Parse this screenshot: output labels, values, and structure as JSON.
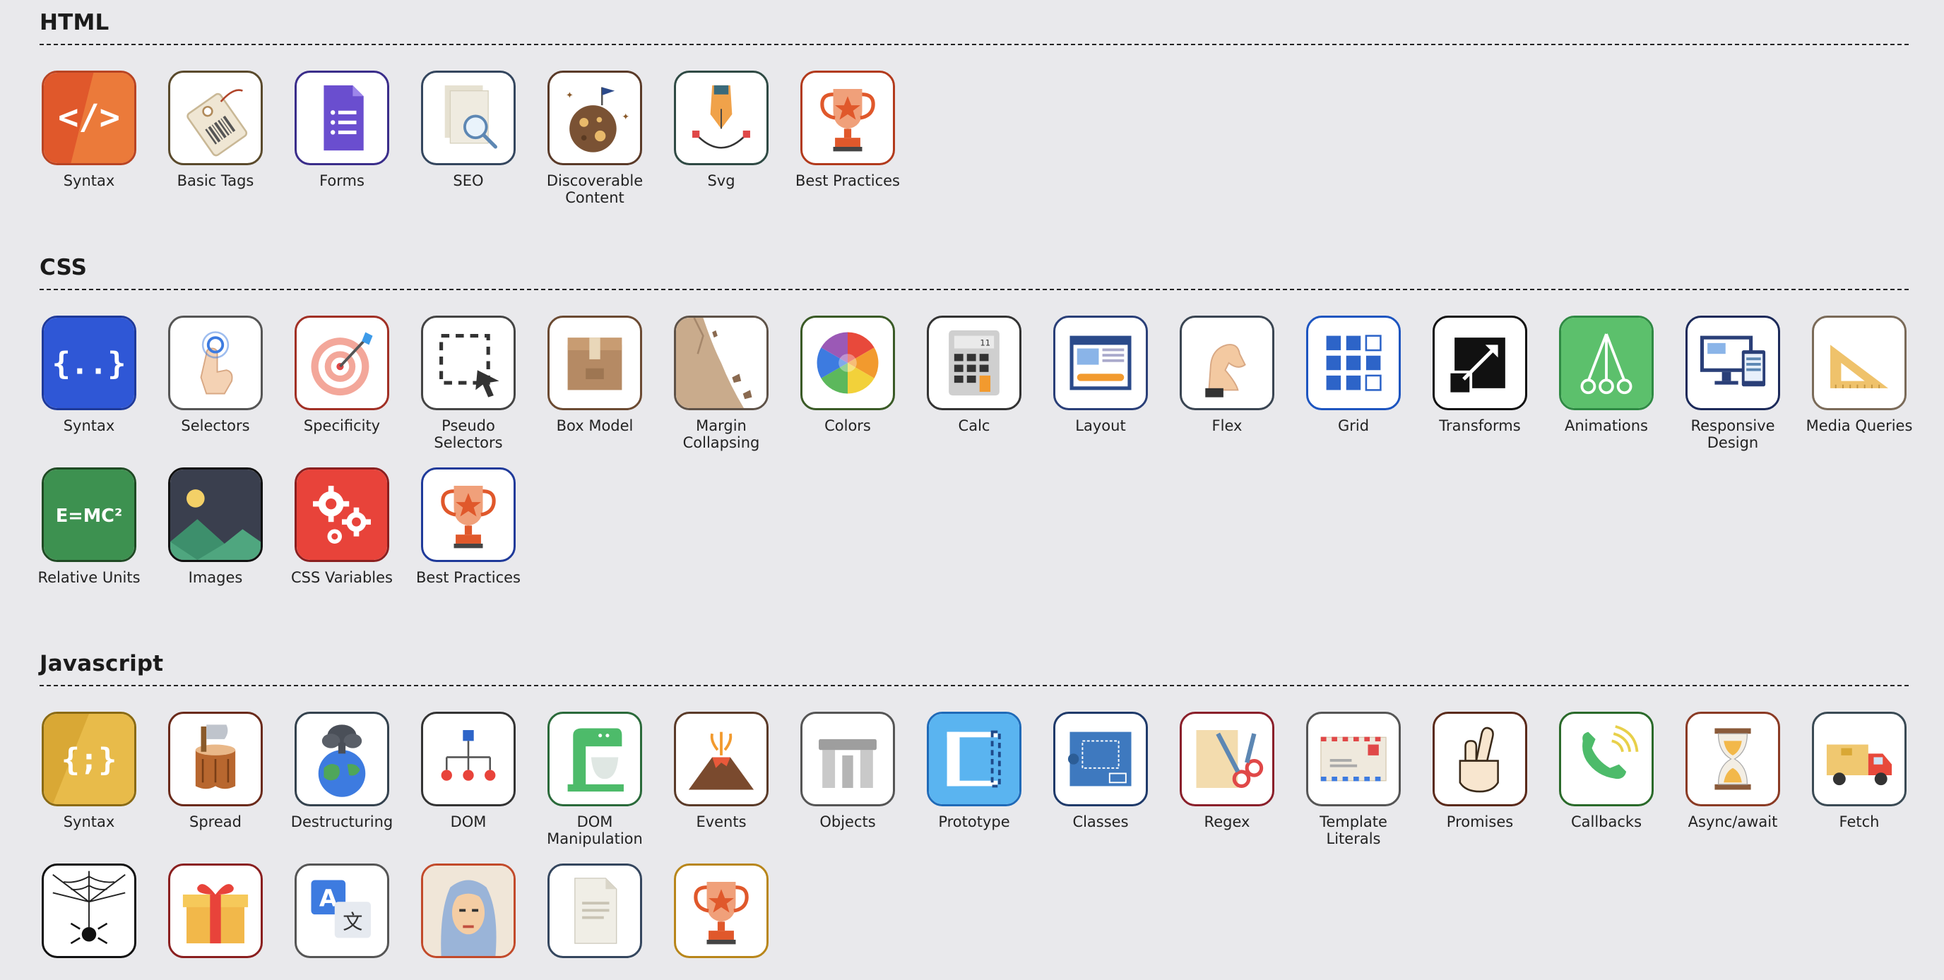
{
  "sections": [
    {
      "title": "HTML",
      "items": [
        {
          "label": "Syntax",
          "icon": "code-brackets-icon",
          "border": "#b84423"
        },
        {
          "label": "Basic Tags",
          "icon": "price-tag-icon",
          "border": "#5a4a2c"
        },
        {
          "label": "Forms",
          "icon": "form-document-icon",
          "border": "#3a2d8a"
        },
        {
          "label": "SEO",
          "icon": "magnifier-document-icon",
          "border": "#34465e"
        },
        {
          "label": "Discoverable Content",
          "icon": "planet-flag-icon",
          "border": "#5a3a28"
        },
        {
          "label": "Svg",
          "icon": "pen-nib-icon",
          "border": "#2f4a44"
        },
        {
          "label": "Best Practices",
          "icon": "trophy-icon",
          "border": "#b23a1c"
        }
      ]
    },
    {
      "title": "CSS",
      "items": [
        {
          "label": "Syntax",
          "icon": "curly-braces-icon",
          "border": "#1f3a9a"
        },
        {
          "label": "Selectors",
          "icon": "pointing-hand-icon",
          "border": "#555"
        },
        {
          "label": "Specificity",
          "icon": "target-icon",
          "border": "#a13025"
        },
        {
          "label": "Pseudo Selectors",
          "icon": "selection-cursor-icon",
          "border": "#444"
        },
        {
          "label": "Box Model",
          "icon": "cardboard-box-icon",
          "border": "#6b4a32"
        },
        {
          "label": "Margin Collapsing",
          "icon": "cliff-icon",
          "border": "#5e5248"
        },
        {
          "label": "Colors",
          "icon": "color-wheel-icon",
          "border": "#3a5a26"
        },
        {
          "label": "Calc",
          "icon": "calculator-icon",
          "border": "#333"
        },
        {
          "label": "Layout",
          "icon": "web-layout-icon",
          "border": "#2a3f78"
        },
        {
          "label": "Flex",
          "icon": "flexed-arm-icon",
          "border": "#3a4552"
        },
        {
          "label": "Grid",
          "icon": "grid-squares-icon",
          "border": "#1d55c0"
        },
        {
          "label": "Transforms",
          "icon": "expand-arrow-icon",
          "border": "#111"
        },
        {
          "label": "Animations",
          "icon": "branching-nodes-icon",
          "border": "#2f8a44"
        },
        {
          "label": "Responsive Design",
          "icon": "devices-icon",
          "border": "#1c2a5a"
        },
        {
          "label": "Media Queries",
          "icon": "set-square-icon",
          "border": "#7a6a58"
        },
        {
          "label": "Relative Units",
          "icon": "emc2-chalkboard-icon",
          "border": "#1f4a24"
        },
        {
          "label": "Images",
          "icon": "landscape-image-icon",
          "border": "#111"
        },
        {
          "label": "CSS Variables",
          "icon": "gears-icon",
          "border": "#8a1f1f"
        },
        {
          "label": "Best Practices",
          "icon": "trophy-icon",
          "border": "#1f3a9a"
        }
      ]
    },
    {
      "title": "Javascript",
      "items": [
        {
          "label": "Syntax",
          "icon": "curly-semicolon-icon",
          "border": "#8a6a14"
        },
        {
          "label": "Spread",
          "icon": "axe-stump-icon",
          "border": "#6a2a1a"
        },
        {
          "label": "Destructuring",
          "icon": "exploding-earth-icon",
          "border": "#34424e"
        },
        {
          "label": "DOM",
          "icon": "tree-hierarchy-icon",
          "border": "#333"
        },
        {
          "label": "DOM Manipulation",
          "icon": "stand-mixer-icon",
          "border": "#2a6a3a"
        },
        {
          "label": "Events",
          "icon": "volcano-icon",
          "border": "#5a3a28"
        },
        {
          "label": "Objects",
          "icon": "stonehenge-icon",
          "border": "#555"
        },
        {
          "label": "Prototype",
          "icon": "prototype-frame-icon",
          "border": "#1f6ab8"
        },
        {
          "label": "Classes",
          "icon": "blueprint-icon",
          "border": "#1f3a6a"
        },
        {
          "label": "Regex",
          "icon": "scissors-icon",
          "border": "#8a1f2a"
        },
        {
          "label": "Template Literals",
          "icon": "envelope-icon",
          "border": "#555"
        },
        {
          "label": "Promises",
          "icon": "crossed-fingers-icon",
          "border": "#5a2a1a"
        },
        {
          "label": "Callbacks",
          "icon": "ringing-phone-icon",
          "border": "#2a6a2a"
        },
        {
          "label": "Async/await",
          "icon": "hourglass-icon",
          "border": "#8a3a24"
        },
        {
          "label": "Fetch",
          "icon": "delivery-truck-icon",
          "border": "#3a4a54"
        },
        {
          "label": "",
          "icon": "spider-web-icon",
          "border": "#111"
        },
        {
          "label": "",
          "icon": "gift-box-icon",
          "border": "#8a1f1f"
        },
        {
          "label": "",
          "icon": "translate-icon",
          "border": "#555"
        },
        {
          "label": "",
          "icon": "woman-portrait-icon",
          "border": "#c24a2a"
        },
        {
          "label": "",
          "icon": "paper-document-icon",
          "border": "#34465e"
        },
        {
          "label": "",
          "icon": "trophy-icon",
          "border": "#b8861a"
        }
      ]
    }
  ]
}
